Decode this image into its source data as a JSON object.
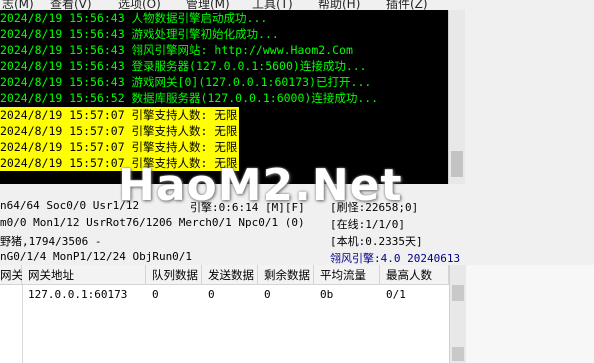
{
  "menu": [
    "志(M)",
    "查看(V)",
    "选项(O)",
    "管理(M)",
    "工具(T)",
    "帮助(H)",
    "插件(Z)"
  ],
  "log": [
    {
      "text": "2024/8/19 15:56:43 人物数据引擎启动成功...",
      "hl": false
    },
    {
      "text": "2024/8/19 15:56:43 游戏处理引擎初始化成功...",
      "hl": false
    },
    {
      "text": "2024/8/19 15:56:43 翎风引擎网站: http://www.Haom2.Com",
      "hl": false
    },
    {
      "text": "2024/8/19 15:56:43 登录服务器(127.0.0.1:5600)连接成功...",
      "hl": false
    },
    {
      "text": "2024/8/19 15:56:43 游戏网关[0](127.0.0.1:60173)已打开...",
      "hl": false
    },
    {
      "text": "2024/8/19 15:56:52 数据库服务器(127.0.0.1:6000)连接成功...",
      "hl": false
    },
    {
      "text": "2024/8/19 15:57:07 引擎支持人数: 无限",
      "hl": true
    },
    {
      "text": "2024/8/19 15:57:07 引擎支持人数: 无限",
      "hl": true
    },
    {
      "text": "2024/8/19 15:57:07 引擎支持人数: 无限",
      "hl": true
    },
    {
      "text": "2024/8/19 15:57:07 引擎支持人数: 无限",
      "hl": true
    }
  ],
  "status": {
    "r1a": "n64/64 Soc0/0 Usr1/12",
    "r1b": "引擎:0:6:14 [M][F]",
    "r1c": "[刷怪:22658;0]",
    "r2a": "m0/0 Mon1/12 UsrRot76/1206 Merch0/1 Npc0/1 (0)",
    "r2c": "[在线:1/1/0]",
    "r3a": "野猪,1794/3506 -",
    "r3c": "[本机:0.2335天]",
    "r4a": "nG0/1/4 MonP1/12/24 ObjRun0/1",
    "r4c": "翎风引擎:4.0 20240613"
  },
  "grid": {
    "headers": [
      "网关",
      "网关地址",
      "队列数据",
      "发送数据",
      "剩余数据",
      "平均流量",
      "最高人数"
    ],
    "rows": [
      [
        "",
        "127.0.0.1:60173",
        "0",
        "0",
        "0",
        "0b",
        "0/1"
      ]
    ]
  },
  "watermark": "HaoM2.Net",
  "colors": {
    "console_bg": "#000000",
    "console_text": "#00ff00",
    "highlight_bg": "#ffff00",
    "version_text": "#00008b"
  }
}
